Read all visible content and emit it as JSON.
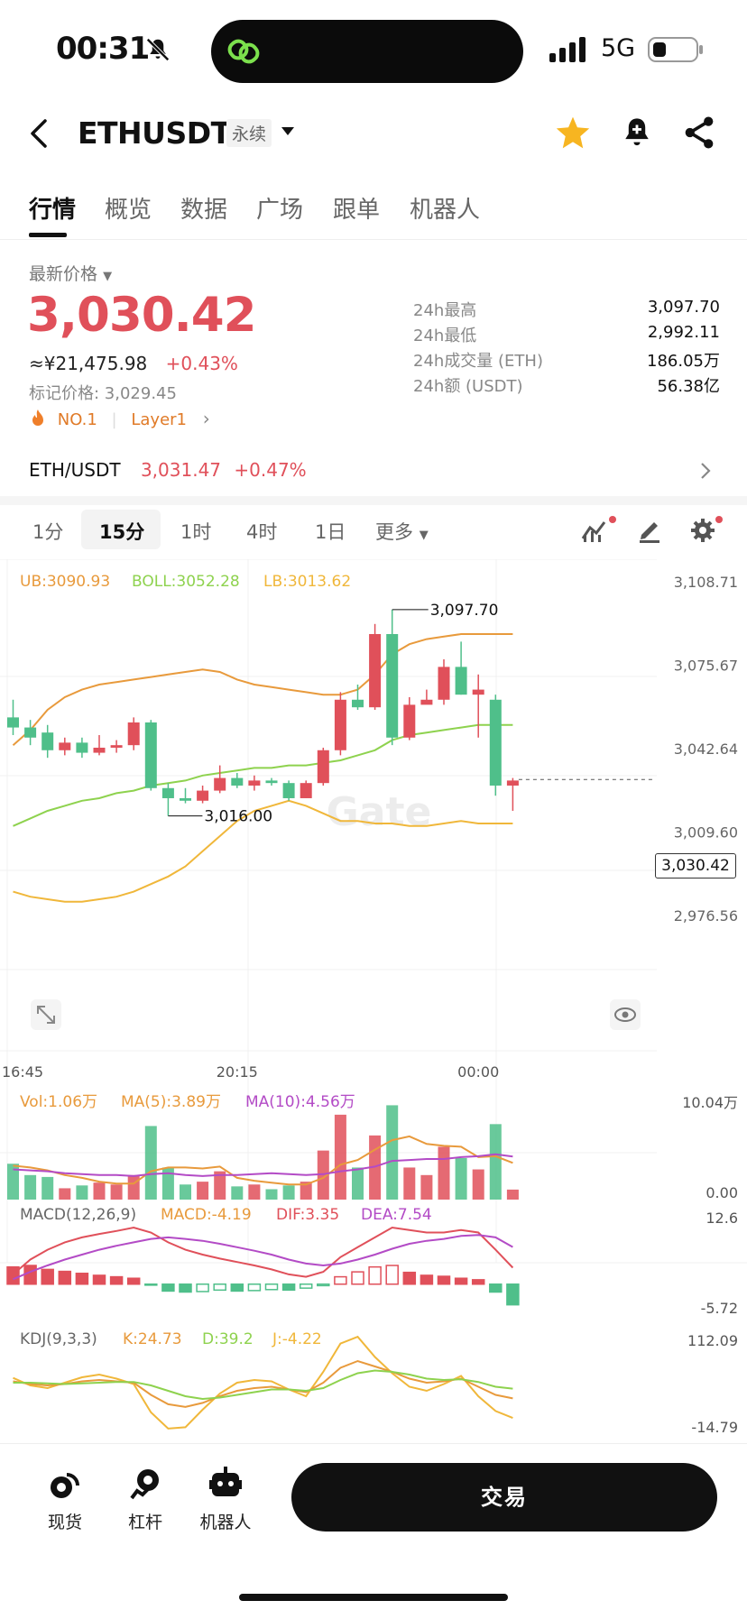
{
  "status_bar": {
    "time": "00:31",
    "network": "5G"
  },
  "header": {
    "symbol": "ETHUSDT",
    "badge": "永续"
  },
  "tabs": [
    "行情",
    "概览",
    "数据",
    "广场",
    "跟单",
    "机器人"
  ],
  "price": {
    "label": "最新价格",
    "last": "3,030.42",
    "cny": "≈¥21,475.98",
    "change": "+0.43%",
    "mark_label": "标记价格: 3,029.45",
    "rank": "NO.1",
    "sector": "Layer1"
  },
  "stats": [
    {
      "label": "24h最高",
      "value": "3,097.70"
    },
    {
      "label": "24h最低",
      "value": "2,992.11"
    },
    {
      "label": "24h成交量 (ETH)",
      "value": "186.05万"
    },
    {
      "label": "24h额 (USDT)",
      "value": "56.38亿"
    }
  ],
  "spot": {
    "pair": "ETH/USDT",
    "price": "3,031.47",
    "change": "+0.47%"
  },
  "intervals": [
    "1分",
    "15分",
    "1时",
    "4时",
    "1日",
    "更多"
  ],
  "colors": {
    "up": "#e0505a",
    "down": "#4fbf8a",
    "ub": "#e89a3c",
    "boll": "#8ed24e",
    "lb": "#f0b73a",
    "ma10": "#b34bc6"
  },
  "chart_data": {
    "type": "candlestick",
    "boll_legend": {
      "ub": "UB:3090.93",
      "boll": "BOLL:3052.28",
      "lb": "LB:3013.62"
    },
    "y_ticks": [
      "3,108.71",
      "3,075.67",
      "3,042.64",
      "3,009.60",
      "2,976.56"
    ],
    "ylim": [
      2976.56,
      3108.71
    ],
    "x_ticks": [
      "16:45",
      "20:15",
      "00:00"
    ],
    "current_price": "3,030.42",
    "high_label": "3,097.70",
    "low_label": "3,016.00",
    "watermark": "Gate",
    "candles": [
      [
        3055,
        3051,
        3062,
        3048
      ],
      [
        3051,
        3047,
        3054,
        3044
      ],
      [
        3049,
        3042,
        3052,
        3039
      ],
      [
        3042,
        3045,
        3047,
        3040
      ],
      [
        3045,
        3041,
        3047,
        3039
      ],
      [
        3041,
        3043,
        3048,
        3040
      ],
      [
        3043,
        3044,
        3046,
        3041
      ],
      [
        3044,
        3053,
        3055,
        3042
      ],
      [
        3053,
        3027,
        3054,
        3026
      ],
      [
        3027,
        3023,
        3029,
        3016
      ],
      [
        3023,
        3022,
        3027,
        3021
      ],
      [
        3022,
        3026,
        3028,
        3021
      ],
      [
        3026,
        3031,
        3036,
        3025
      ],
      [
        3031,
        3028,
        3033,
        3027
      ],
      [
        3028,
        3030,
        3032,
        3026
      ],
      [
        3030,
        3029,
        3031,
        3028
      ],
      [
        3029,
        3023,
        3030,
        3022
      ],
      [
        3023,
        3029,
        3030,
        3023
      ],
      [
        3029,
        3042,
        3043,
        3028
      ],
      [
        3042,
        3062,
        3065,
        3040
      ],
      [
        3062,
        3059,
        3068,
        3058
      ],
      [
        3059,
        3088,
        3092,
        3058
      ],
      [
        3088,
        3047,
        3097.7,
        3044
      ],
      [
        3047,
        3060,
        3063,
        3046
      ],
      [
        3060,
        3062,
        3066,
        3061
      ],
      [
        3062,
        3075,
        3078,
        3060
      ],
      [
        3075,
        3064,
        3085,
        3064
      ],
      [
        3064,
        3066,
        3072,
        3047
      ],
      [
        3062,
        3028,
        3064,
        3024
      ],
      [
        3028,
        3030,
        3031,
        3018
      ]
    ],
    "ub": [
      3044,
      3050,
      3058,
      3063,
      3066,
      3068,
      3069,
      3070,
      3071,
      3072,
      3073,
      3074,
      3073,
      3070,
      3068,
      3067,
      3066,
      3065,
      3064,
      3064,
      3066,
      3072,
      3080,
      3084,
      3086,
      3087,
      3088,
      3088,
      3088,
      3088
    ],
    "mid": [
      3012,
      3015,
      3018,
      3020,
      3022,
      3023,
      3025,
      3026,
      3028,
      3029,
      3030,
      3032,
      3033,
      3034,
      3035,
      3035,
      3036,
      3036,
      3037,
      3038,
      3040,
      3042,
      3046,
      3048,
      3049,
      3050,
      3051,
      3052,
      3052,
      3052
    ],
    "lb": [
      2986,
      2984,
      2983,
      2982,
      2982,
      2983,
      2984,
      2986,
      2989,
      2992,
      2996,
      3002,
      3008,
      3014,
      3018,
      3020,
      3022,
      3020,
      3017,
      3014,
      3014,
      3013,
      3013,
      3012,
      3012,
      3013,
      3014,
      3013,
      3013,
      3013
    ],
    "vol": {
      "legend": {
        "vol": "Vol:1.06万",
        "ma5": "MA(5):3.89万",
        "ma10": "MA(10):4.56万"
      },
      "max_label": "10.04万",
      "min_label": "0.00",
      "values": [
        3.8,
        2.6,
        2.4,
        1.2,
        1.5,
        1.8,
        1.6,
        2.6,
        7.8,
        3.4,
        1.6,
        1.9,
        3.0,
        1.4,
        1.6,
        1.1,
        1.5,
        1.9,
        5.2,
        9.0,
        3.4,
        6.8,
        10.0,
        3.4,
        2.6,
        5.6,
        4.4,
        3.2,
        8.0,
        1.06
      ],
      "ma5": [
        3.6,
        3.4,
        3.1,
        2.6,
        2.3,
        1.9,
        1.7,
        1.7,
        3.0,
        3.4,
        3.4,
        3.3,
        3.5,
        2.3,
        2.0,
        1.8,
        1.6,
        1.6,
        2.3,
        3.7,
        4.2,
        5.3,
        6.3,
        6.7,
        5.9,
        5.7,
        5.6,
        4.5,
        4.6,
        3.89
      ],
      "ma10": [
        3.2,
        3.1,
        3.0,
        2.8,
        2.7,
        2.6,
        2.6,
        2.5,
        2.7,
        2.8,
        2.6,
        2.5,
        2.6,
        2.6,
        2.7,
        2.8,
        2.7,
        2.6,
        2.7,
        3.0,
        3.2,
        3.5,
        4.1,
        4.2,
        4.3,
        4.3,
        4.5,
        4.6,
        4.8,
        4.56
      ]
    },
    "macd": {
      "legend": {
        "params": "MACD(12,26,9)",
        "macd": "MACD:-4.19",
        "dif": "DIF:3.35",
        "dea": "DEA:7.54"
      },
      "max_label": "12.6",
      "min_label": "-5.72",
      "hist": [
        3.5,
        3.8,
        3.0,
        2.6,
        2.2,
        1.8,
        1.5,
        1.2,
        -0.2,
        -1.4,
        -1.6,
        -1.5,
        -1.2,
        -1.4,
        -1.3,
        -1.1,
        -1.2,
        -0.8,
        -0.3,
        1.5,
        2.5,
        3.5,
        3.8,
        2.4,
        1.8,
        1.6,
        1.2,
        0.9,
        -1.6,
        -4.19
      ],
      "dif": [
        2.0,
        5.0,
        7.0,
        8.5,
        9.5,
        10.2,
        10.8,
        11.5,
        10.5,
        8.5,
        7.0,
        6.0,
        5.2,
        4.5,
        3.8,
        3.0,
        2.0,
        1.5,
        2.5,
        5.5,
        7.5,
        9.5,
        11.5,
        11.0,
        10.5,
        10.5,
        11.0,
        10.5,
        7.0,
        3.35
      ],
      "dea": [
        1.0,
        2.5,
        3.8,
        5.0,
        6.0,
        7.0,
        7.8,
        8.5,
        9.2,
        9.5,
        9.2,
        8.8,
        8.2,
        7.5,
        6.8,
        6.0,
        5.0,
        4.2,
        3.8,
        4.2,
        5.0,
        6.0,
        7.2,
        8.2,
        8.8,
        9.2,
        9.8,
        10.0,
        9.5,
        7.54
      ]
    },
    "kdj": {
      "legend": {
        "params": "KDJ(9,3,3)",
        "k": "K:24.73",
        "d": "D:39.2",
        "j": "J:-4.22"
      },
      "max_label": "112.09",
      "min_label": "-14.79",
      "k": [
        50,
        46,
        44,
        46,
        50,
        52,
        50,
        48,
        30,
        16,
        12,
        18,
        28,
        36,
        40,
        42,
        38,
        34,
        48,
        70,
        80,
        72,
        64,
        54,
        48,
        50,
        54,
        42,
        30,
        24.73
      ],
      "d": [
        48,
        48,
        47,
        46,
        47,
        48,
        49,
        49,
        44,
        36,
        28,
        24,
        26,
        30,
        34,
        38,
        38,
        36,
        40,
        52,
        62,
        66,
        64,
        60,
        54,
        52,
        53,
        49,
        42,
        39.2
      ],
      "j": [
        55,
        44,
        40,
        48,
        56,
        60,
        54,
        46,
        4,
        -20,
        -18,
        8,
        32,
        48,
        52,
        50,
        38,
        28,
        64,
        106,
        116,
        86,
        62,
        42,
        36,
        46,
        58,
        28,
        6,
        -4.22
      ]
    }
  },
  "bottom_nav": [
    "现货",
    "杠杆",
    "机器人"
  ],
  "trade_label": "交易"
}
